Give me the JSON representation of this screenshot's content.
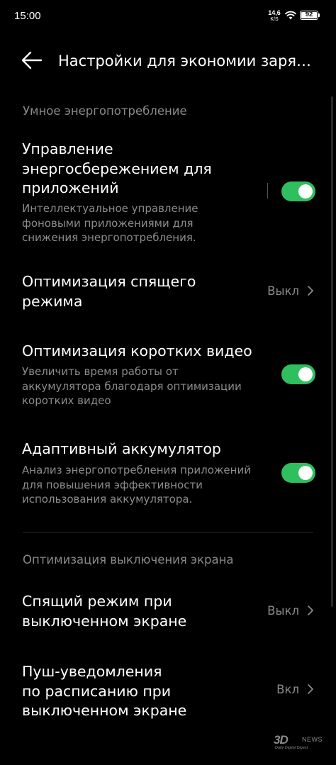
{
  "status_bar": {
    "time": "15:00",
    "net_speed_value": "14,6",
    "net_speed_unit": "K/S",
    "battery_level": "92"
  },
  "header": {
    "title": "Настройки для экономии заря…"
  },
  "sections": [
    {
      "label": "Умное энергопотребление",
      "items": [
        {
          "title_lines": [
            "Управление",
            "энергосбережением для",
            "приложений"
          ],
          "desc_lines": [
            "Интеллектуальное управление",
            "фоновыми приложениями для",
            "снижения энергопотребления."
          ],
          "toggle_on": true
        },
        {
          "title_lines": [
            "Оптимизация спящего",
            "режима"
          ],
          "value": "Выкл"
        },
        {
          "title_lines": [
            "Оптимизация коротких видео"
          ],
          "desc_lines": [
            "Увеличить время работы от",
            "аккумулятора благодаря оптимизации",
            "коротких видео"
          ],
          "toggle_on": true
        },
        {
          "title_lines": [
            "Адаптивный аккумулятор"
          ],
          "desc_lines": [
            "Анализ энергопотребления приложений",
            "для повышения эффективности",
            "использования аккумулятора."
          ],
          "toggle_on": true
        }
      ]
    },
    {
      "label": "Оптимизация выключения экрана",
      "items": [
        {
          "title_lines": [
            "Спящий режим при",
            "выключенном экране"
          ],
          "value": "Выкл"
        },
        {
          "title_lines": [
            "Пуш-уведомления",
            "по расписанию при",
            "выключенном экране"
          ],
          "value": "Вкл"
        }
      ]
    }
  ],
  "colors": {
    "background": "#000000",
    "accent_toggle": "#2fbf5e",
    "secondary_text": "#8a8a8a"
  },
  "icons": {
    "back": "arrow-left-icon",
    "chevron": "chevron-right-icon",
    "wifi": "wifi-icon",
    "battery": "battery-icon"
  },
  "watermark": {
    "brand": "3D",
    "news": "NEWS",
    "tagline": "Daily Digital Digest"
  }
}
